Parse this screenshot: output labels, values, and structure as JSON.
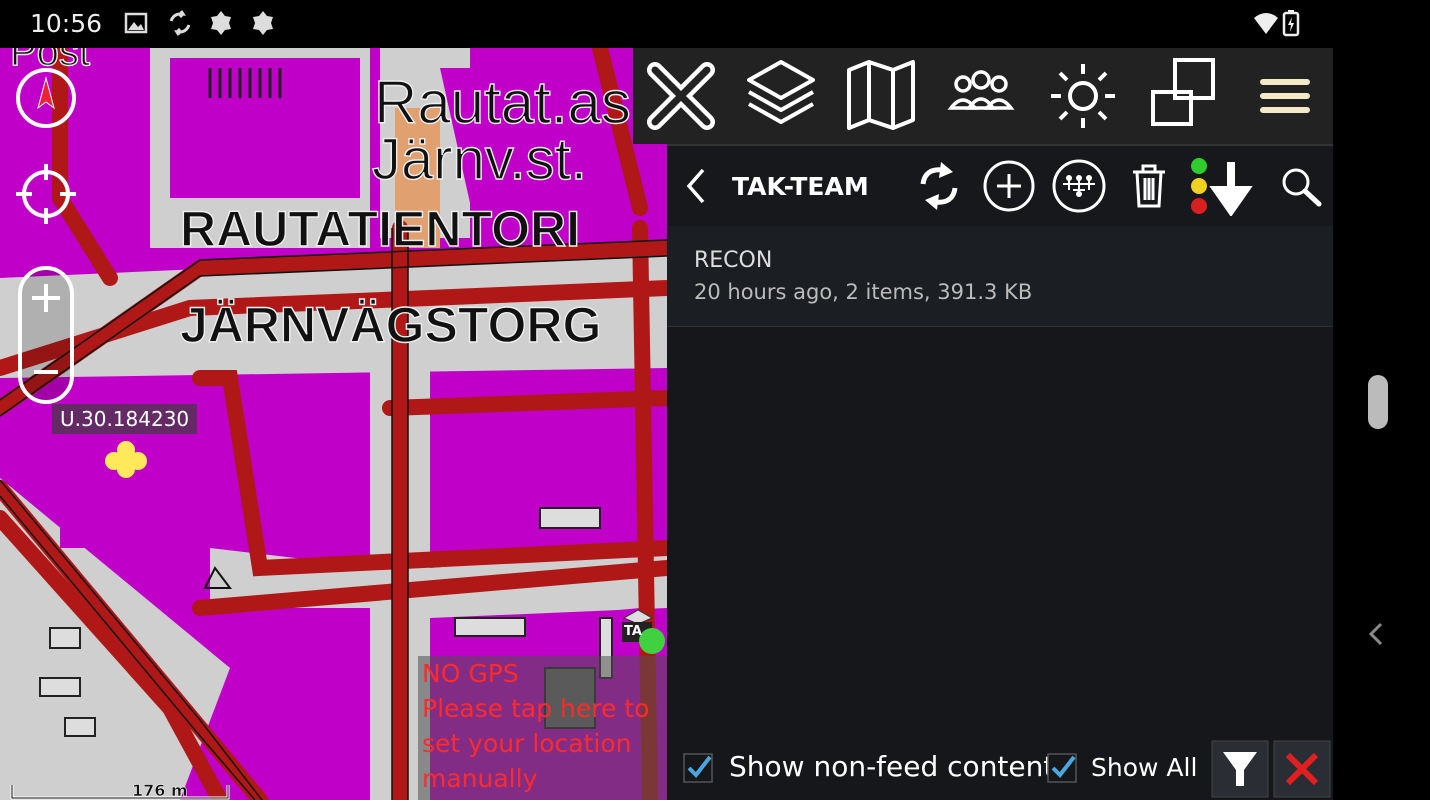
{
  "status_bar": {
    "time": "10:56",
    "icons": [
      "image-icon",
      "sync-icon",
      "notification-icon",
      "notification-icon",
      "wifi-icon",
      "battery-charging-icon"
    ]
  },
  "map": {
    "labels": {
      "station_1": "Rautat.as",
      "station_2": "Järnv.st.",
      "square_1": "RAUTATIENTORI",
      "square_2": "JÄRNVÄGSTORG",
      "post": "Post"
    },
    "marker_label": "U.30.184230",
    "no_gps_lines": [
      "NO GPS",
      "Please tap here to",
      "set your location",
      "manually"
    ],
    "scale": "176 m",
    "self_marker_label": "TA"
  },
  "toolbar": {
    "buttons": [
      "close-icon",
      "layers-icon",
      "map-icon",
      "team-icon",
      "brightness-icon",
      "multi-window-icon",
      "menu-icon"
    ]
  },
  "panel": {
    "title": "TAK-TEAM",
    "items": [
      {
        "name": "RECON",
        "meta": "20 hours ago, 2 items, 391.3 KB"
      }
    ],
    "footer": {
      "show_non_feed": {
        "label": "Show non-feed content",
        "checked": true
      },
      "show_all": {
        "label": "Show All",
        "checked": true
      }
    }
  },
  "colors": {
    "map_purple": "#c000c8",
    "road_red": "#b01818",
    "panel_bg": "#15171b",
    "toolbar_bg": "#222222",
    "checkbox_blue": "#4aa8e0",
    "nogps_red": "#ff2a2a"
  }
}
